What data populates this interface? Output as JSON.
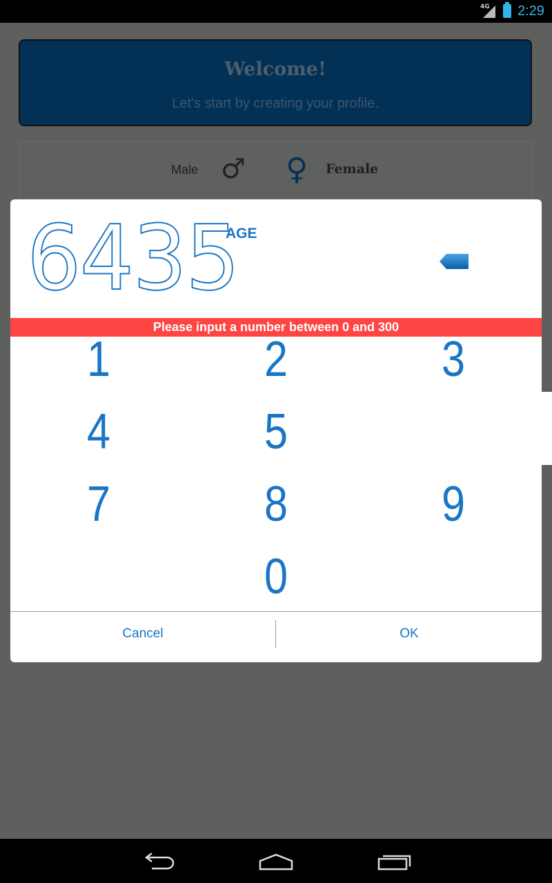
{
  "statusbar": {
    "network": "4G",
    "time": "2:29"
  },
  "welcome": {
    "title": "Welcome!",
    "subtitle": "Let's start by creating your profile."
  },
  "gender": {
    "male_label": "Male",
    "male_icon": "♂",
    "female_icon": "♀",
    "female_label": "Female"
  },
  "dialog": {
    "value": "6435",
    "unit": "AGE",
    "error": "Please input a number between 0 and 300",
    "keys": [
      "1",
      "2",
      "3",
      "4",
      "5",
      "7",
      "8",
      "9",
      "0"
    ],
    "cancel": "Cancel",
    "ok": "OK"
  },
  "colors": {
    "accent": "#1976c6",
    "error": "#ff4444",
    "scrim": "#5e605e"
  },
  "icons": {
    "backspace": "backspace-icon",
    "back": "back-icon",
    "home": "home-icon",
    "recents": "recents-icon"
  }
}
